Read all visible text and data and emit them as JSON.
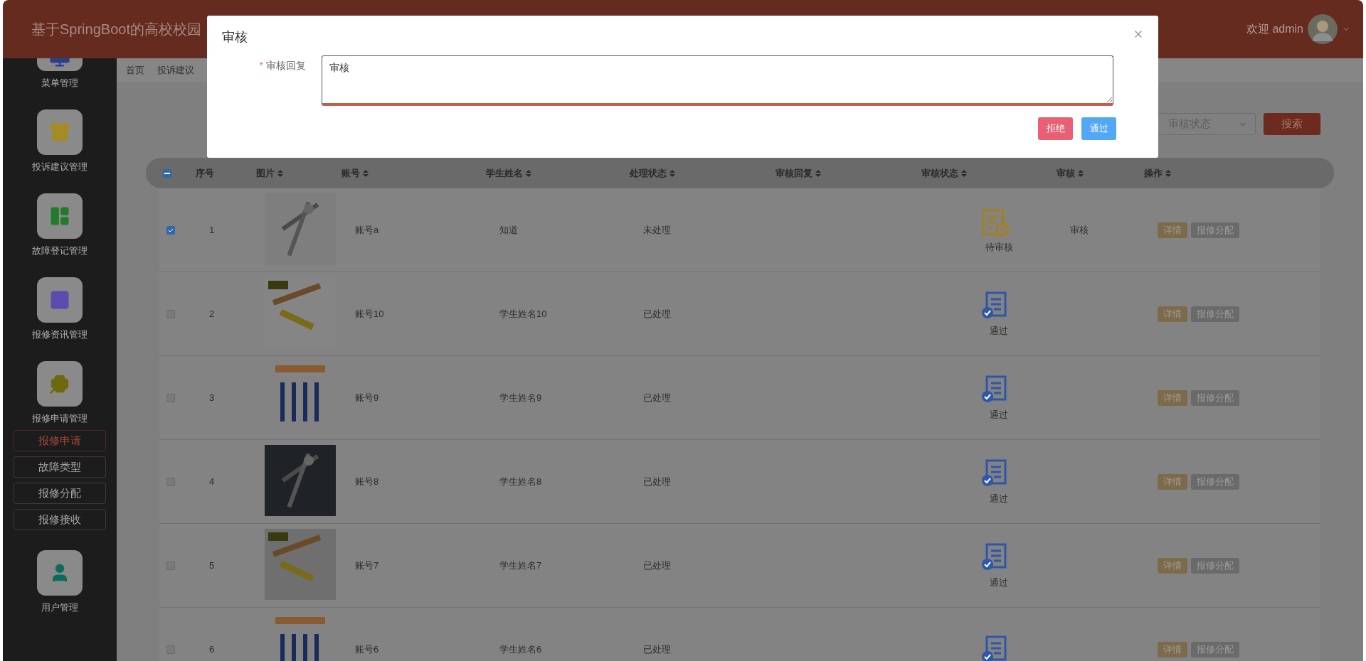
{
  "header": {
    "title": "基于SpringBoot的高校校园",
    "greeting": "欢迎 admin"
  },
  "sidebar": {
    "items": [
      {
        "label": "菜单管理"
      },
      {
        "label": "投诉建议管理"
      },
      {
        "label": "故障登记管理"
      },
      {
        "label": "报修资讯管理"
      },
      {
        "label": "报修申请管理",
        "children": [
          {
            "label": "报修申请",
            "selected": true
          },
          {
            "label": "故障类型",
            "selected": false
          },
          {
            "label": "报修分配",
            "selected": false
          },
          {
            "label": "报修接收",
            "selected": false
          }
        ]
      },
      {
        "label": "用户管理"
      }
    ]
  },
  "breadcrumb": [
    "首页",
    "投诉建议"
  ],
  "search": {
    "placeholder": "审核状态",
    "button": "搜索"
  },
  "table": {
    "select_all": {
      "indeterminate": true
    },
    "columns": [
      "序号",
      "图片",
      "账号",
      "学生姓名",
      "处理状态",
      "审核回复",
      "审核状态",
      "审核",
      "操作"
    ],
    "rows": [
      {
        "selected": true,
        "index": "1",
        "account": "账号a",
        "name": "知道",
        "process_status": "未处理",
        "review_status": {
          "kind": "pending",
          "label": "待审核"
        },
        "review_action": "审核",
        "actions": [
          "详情",
          "报修分配"
        ]
      },
      {
        "selected": false,
        "index": "2",
        "account": "账号10",
        "name": "学生姓名10",
        "process_status": "已处理",
        "review_status": {
          "kind": "approved",
          "label": "通过"
        },
        "actions": [
          "详情",
          "报修分配"
        ]
      },
      {
        "selected": false,
        "index": "3",
        "account": "账号9",
        "name": "学生姓名9",
        "process_status": "已处理",
        "review_status": {
          "kind": "approved",
          "label": "通过"
        },
        "actions": [
          "详情",
          "报修分配"
        ]
      },
      {
        "selected": false,
        "index": "4",
        "account": "账号8",
        "name": "学生姓名8",
        "process_status": "已处理",
        "review_status": {
          "kind": "approved",
          "label": "通过"
        },
        "actions": [
          "详情",
          "报修分配"
        ]
      },
      {
        "selected": false,
        "index": "5",
        "account": "账号7",
        "name": "学生姓名7",
        "process_status": "已处理",
        "review_status": {
          "kind": "approved",
          "label": "通过"
        },
        "actions": [
          "详情",
          "报修分配"
        ]
      },
      {
        "selected": false,
        "index": "6",
        "account": "账号6",
        "name": "学生姓名6",
        "process_status": "已处理",
        "review_status": {
          "kind": "approved"
        },
        "actions": [
          "详情",
          "报修分配"
        ]
      }
    ]
  },
  "dialog": {
    "title": "审核",
    "field": {
      "required_mark": "*",
      "label": "审核回复",
      "value": "审核"
    },
    "buttons": [
      {
        "kind": "reject",
        "label": "拒绝"
      },
      {
        "kind": "approve",
        "label": "通过"
      }
    ]
  }
}
